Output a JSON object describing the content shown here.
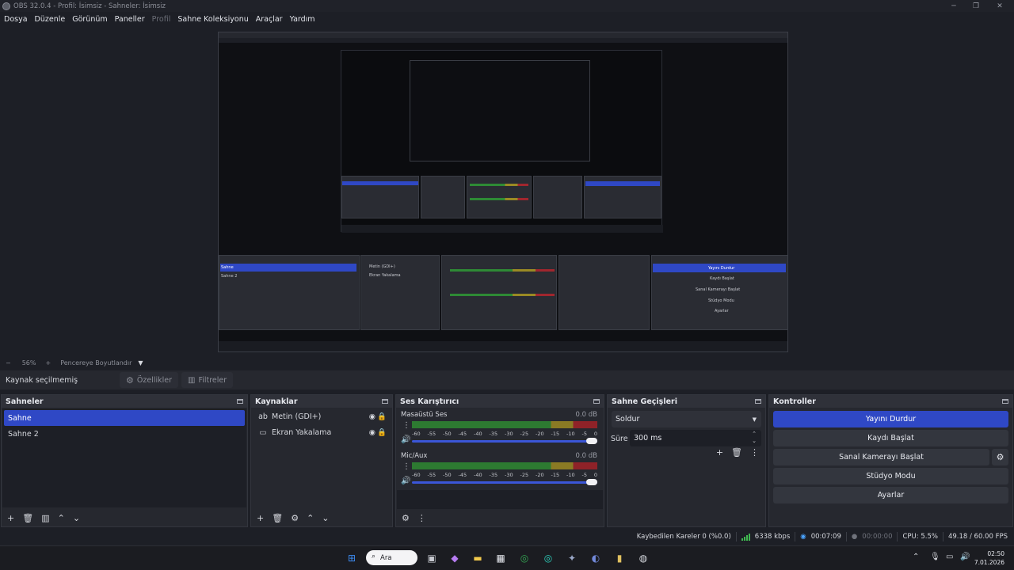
{
  "window": {
    "title": "OBS 32.0.4 - Profil: İsimsiz - Sahneler: İsimsiz",
    "minimize": "─",
    "maximize": "❐",
    "close": "✕"
  },
  "menu": {
    "items": [
      "Dosya",
      "Düzenle",
      "Görünüm",
      "Paneller",
      "Profil",
      "Sahne Koleksiyonu",
      "Araçlar",
      "Yardım"
    ]
  },
  "zoom": {
    "minus": "−",
    "value": "56%",
    "plus": "+",
    "fit_label": "Pencereye Boyutlandır",
    "caret": "▼"
  },
  "source_toolbar": {
    "no_source": "Kaynak seçilmemiş",
    "properties": "Özellikler",
    "filters": "Filtreler"
  },
  "scenes": {
    "title": "Sahneler",
    "items": [
      "Sahne",
      "Sahne 2"
    ],
    "selected_index": 0
  },
  "sources": {
    "title": "Kaynaklar",
    "items": [
      {
        "name": "Metin (GDI+)",
        "icon": "text-icon"
      },
      {
        "name": "Ekran Yakalama",
        "icon": "monitor-icon"
      }
    ]
  },
  "mixer": {
    "title": "Ses Karıştırıcı",
    "channels": [
      {
        "name": "Masaüstü Ses",
        "db": "0.0 dB"
      },
      {
        "name": "Mic/Aux",
        "db": "0.0 dB"
      }
    ],
    "ticks": [
      "-60",
      "-55",
      "-50",
      "-45",
      "-40",
      "-35",
      "-30",
      "-25",
      "-20",
      "-15",
      "-10",
      "-5",
      "0"
    ]
  },
  "transitions": {
    "title": "Sahne Geçişleri",
    "selected": "Soldur",
    "duration_label": "Süre",
    "duration_value": "300 ms"
  },
  "controls": {
    "title": "Kontroller",
    "stop_stream": "Yayını Durdur",
    "start_record": "Kaydı Başlat",
    "virtual_cam": "Sanal Kamerayı Başlat",
    "studio_mode": "Stüdyo Modu",
    "settings": "Ayarlar"
  },
  "status": {
    "dropped": "Kaybedilen Kareler 0 (%0.0)",
    "bitrate": "6338 kbps",
    "stream_time": "00:07:09",
    "record_time": "00:00:00",
    "cpu": "CPU: 5.5%",
    "fps": "49.18 / 60.00 FPS"
  },
  "taskbar": {
    "search": "Ara",
    "time": "02:50",
    "date": "7.01.2026"
  },
  "colors": {
    "accent": "#2f48c5",
    "background": "#1d1f26",
    "dock": "#26282f"
  }
}
